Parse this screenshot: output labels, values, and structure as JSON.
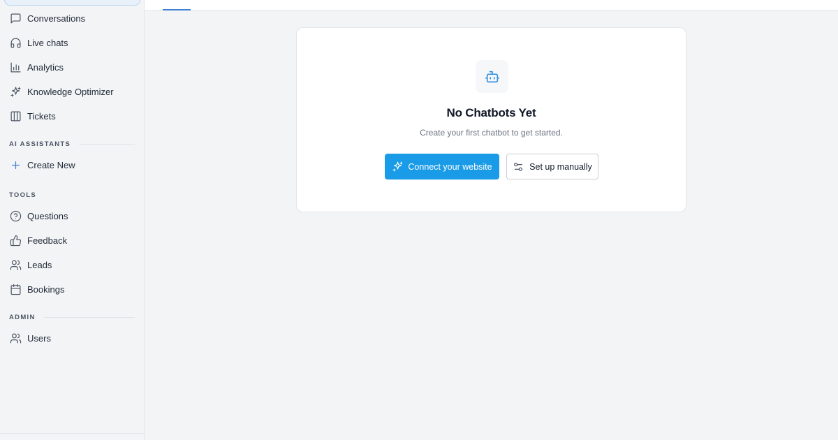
{
  "sidebar": {
    "items": [
      {
        "label": "Conversations",
        "icon": "message-square-icon"
      },
      {
        "label": "Live chats",
        "icon": "headphones-icon"
      },
      {
        "label": "Analytics",
        "icon": "bar-chart-icon"
      },
      {
        "label": "Knowledge Optimizer",
        "icon": "sparkles-icon"
      },
      {
        "label": "Tickets",
        "icon": "columns-icon"
      }
    ],
    "sections": {
      "ai_assistants": {
        "title": "AI ASSISTANTS",
        "items": [
          {
            "label": "Create New",
            "icon": "plus-icon"
          }
        ]
      },
      "tools": {
        "title": "TOOLS",
        "items": [
          {
            "label": "Questions",
            "icon": "help-circle-icon"
          },
          {
            "label": "Feedback",
            "icon": "thumbs-up-icon"
          },
          {
            "label": "Leads",
            "icon": "users-icon"
          },
          {
            "label": "Bookings",
            "icon": "calendar-icon"
          }
        ]
      },
      "admin": {
        "title": "ADMIN",
        "items": [
          {
            "label": "Users",
            "icon": "users-icon"
          }
        ]
      }
    }
  },
  "empty_state": {
    "icon": "bot-icon",
    "title": "No Chatbots Yet",
    "subtitle": "Create your first chatbot to get started.",
    "primary_button": {
      "label": "Connect your website",
      "icon": "sparkles-icon"
    },
    "secondary_button": {
      "label": "Set up manually",
      "icon": "sliders-icon"
    }
  },
  "colors": {
    "accent": "#1a9be8",
    "background": "#f3f4f6",
    "card": "#ffffff"
  }
}
